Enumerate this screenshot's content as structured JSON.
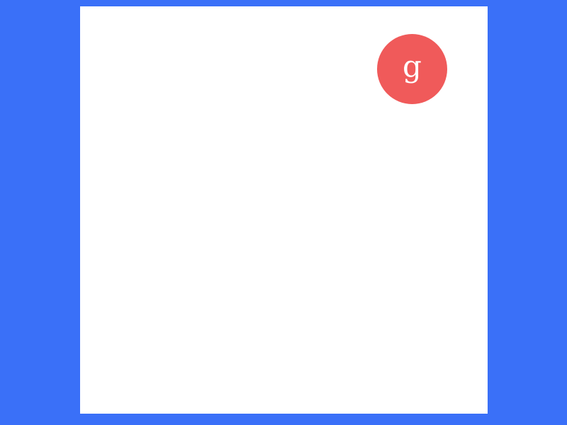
{
  "colors": {
    "page_background": "#3a70f8",
    "panel_background": "#ffffff",
    "avatar_background": "#f05a5a",
    "avatar_text": "#ffffff"
  },
  "avatar": {
    "letter": "g",
    "icon_name": "user-avatar-icon"
  }
}
